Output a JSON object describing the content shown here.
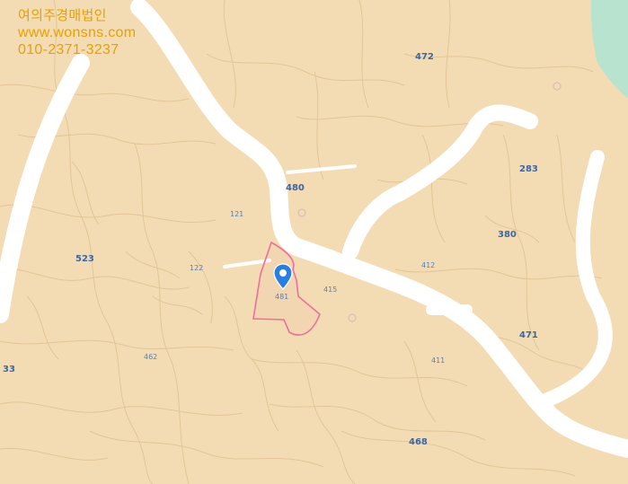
{
  "brand": {
    "name": "여의주경매법인",
    "website": "www.wonsns.com",
    "phone": "010-2371-3237",
    "color": "#e8a100"
  },
  "map": {
    "colors": {
      "land": "#f3dcb3",
      "parcel_border": "#e2c597",
      "road": "#ffffff",
      "water": "#b8e3cf",
      "highlight": "#ee6f9a",
      "marker": "#2a7de1"
    },
    "labels": [
      {
        "text": "472",
        "big": true
      },
      {
        "text": "480",
        "big": true
      },
      {
        "text": "380",
        "big": true
      },
      {
        "text": "283",
        "big": true
      },
      {
        "text": "523",
        "big": true
      },
      {
        "text": "471",
        "big": true
      },
      {
        "text": "468",
        "big": true
      },
      {
        "text": "33",
        "big": true
      },
      {
        "text": "481",
        "big": false
      },
      {
        "text": "412",
        "big": false
      },
      {
        "text": "121",
        "big": false
      },
      {
        "text": "122",
        "big": false
      },
      {
        "text": "415",
        "big": false
      },
      {
        "text": "462",
        "big": false
      },
      {
        "text": "411",
        "big": false
      }
    ],
    "marker": {
      "icon": "location-pin-icon"
    }
  }
}
